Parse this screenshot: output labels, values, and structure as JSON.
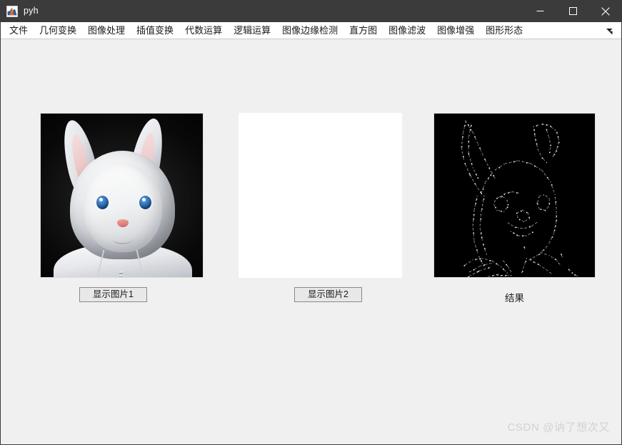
{
  "window": {
    "title": "pyh",
    "app_icon": "matlab-icon",
    "controls": {
      "minimize": "minimize-icon",
      "maximize": "maximize-icon",
      "close": "close-icon"
    }
  },
  "menubar": {
    "items": [
      {
        "label": "文件"
      },
      {
        "label": "几何变换"
      },
      {
        "label": "图像处理"
      },
      {
        "label": "插值变换"
      },
      {
        "label": "代数运算"
      },
      {
        "label": "逻辑运算"
      },
      {
        "label": "图像边缘检测"
      },
      {
        "label": "直方图"
      },
      {
        "label": "图像滤波"
      },
      {
        "label": "图像增强"
      },
      {
        "label": "图形形态"
      }
    ],
    "overflow_icon": "menu-overflow-arrow-icon"
  },
  "main": {
    "panels": [
      {
        "name": "image-panel-1",
        "kind": "photo",
        "content": "white rabbit character in hoodie on dark background"
      },
      {
        "name": "image-panel-2",
        "kind": "blank",
        "content": ""
      },
      {
        "name": "image-panel-3",
        "kind": "edges",
        "content": "edge detection result of rabbit character"
      }
    ],
    "buttons": [
      {
        "label": "显示图片1"
      },
      {
        "label": "显示图片2"
      }
    ],
    "result_label": "结果"
  },
  "watermark": {
    "text": "CSDN @讷了想次又"
  },
  "colors": {
    "titlebar_bg": "#3b3b3b",
    "window_bg": "#f0f0f0",
    "menubar_bg": "#ffffff",
    "button_bg": "#e8e8e8",
    "button_border": "#8a8a8a",
    "watermark": "#d2d2d2"
  }
}
